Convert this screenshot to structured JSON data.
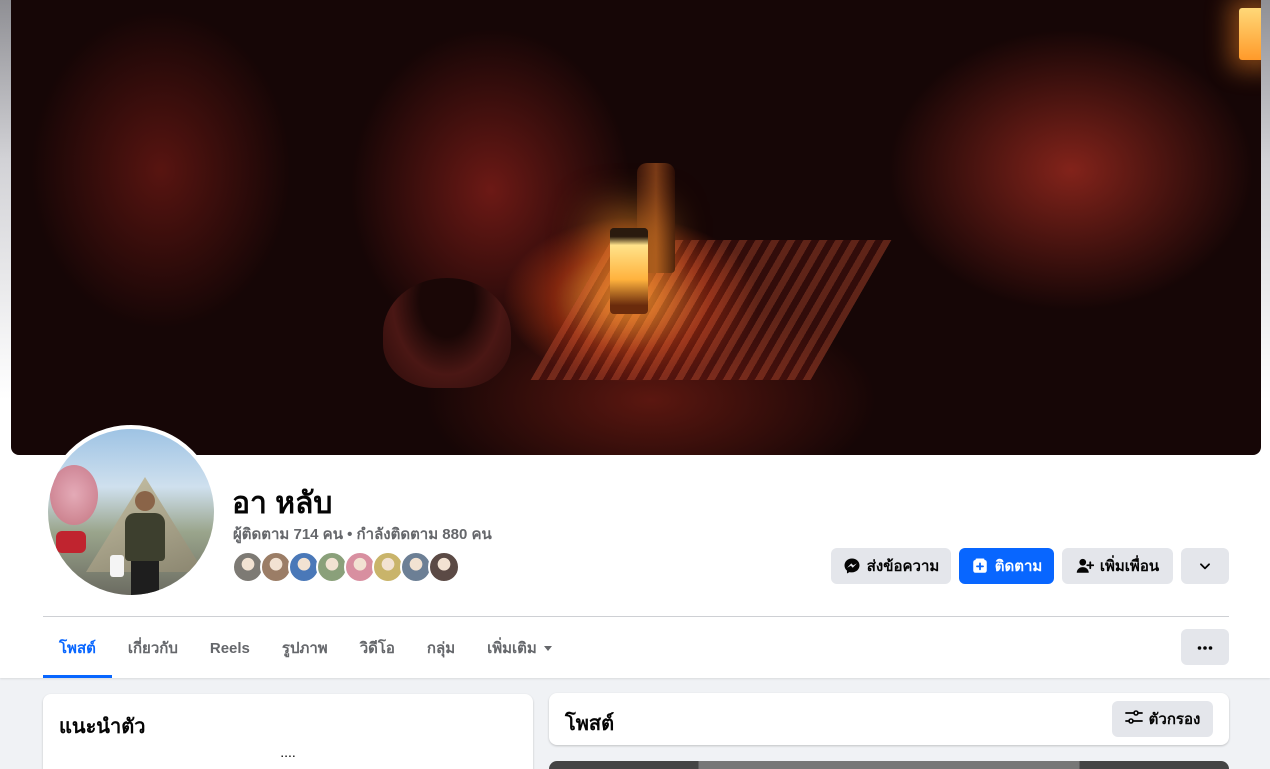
{
  "profile": {
    "name": "อา หลับ",
    "follow_stats": "ผู้ติดตาม 714 คน • กำลังติดตาม 880 คน"
  },
  "friends_preview": {
    "colors": [
      "#7d7a74",
      "#9b7d66",
      "#4a78b8",
      "#8aa07a",
      "#d88fa0",
      "#c9b46a",
      "#6c7f95",
      "#5b4a45"
    ]
  },
  "actions": {
    "message_label": "ส่งข้อความ",
    "follow_label": "ติดตาม",
    "add_friend_label": "เพิ่มเพื่อน"
  },
  "tabs": [
    {
      "label": "โพสต์",
      "active": true
    },
    {
      "label": "เกี่ยวกับ"
    },
    {
      "label": "Reels"
    },
    {
      "label": "รูปภาพ"
    },
    {
      "label": "วิดีโอ"
    },
    {
      "label": "กลุ่ม"
    },
    {
      "label": "เพิ่มเติม"
    }
  ],
  "intro": {
    "title": "แนะนำตัว",
    "text": "...."
  },
  "posts": {
    "title": "โพสต์",
    "filter_label": "ตัวกรอง"
  },
  "colors": {
    "accent": "#0866ff",
    "secondary_button": "#e4e6eb",
    "page_bg": "#f0f2f5",
    "muted_text": "#65676b"
  }
}
